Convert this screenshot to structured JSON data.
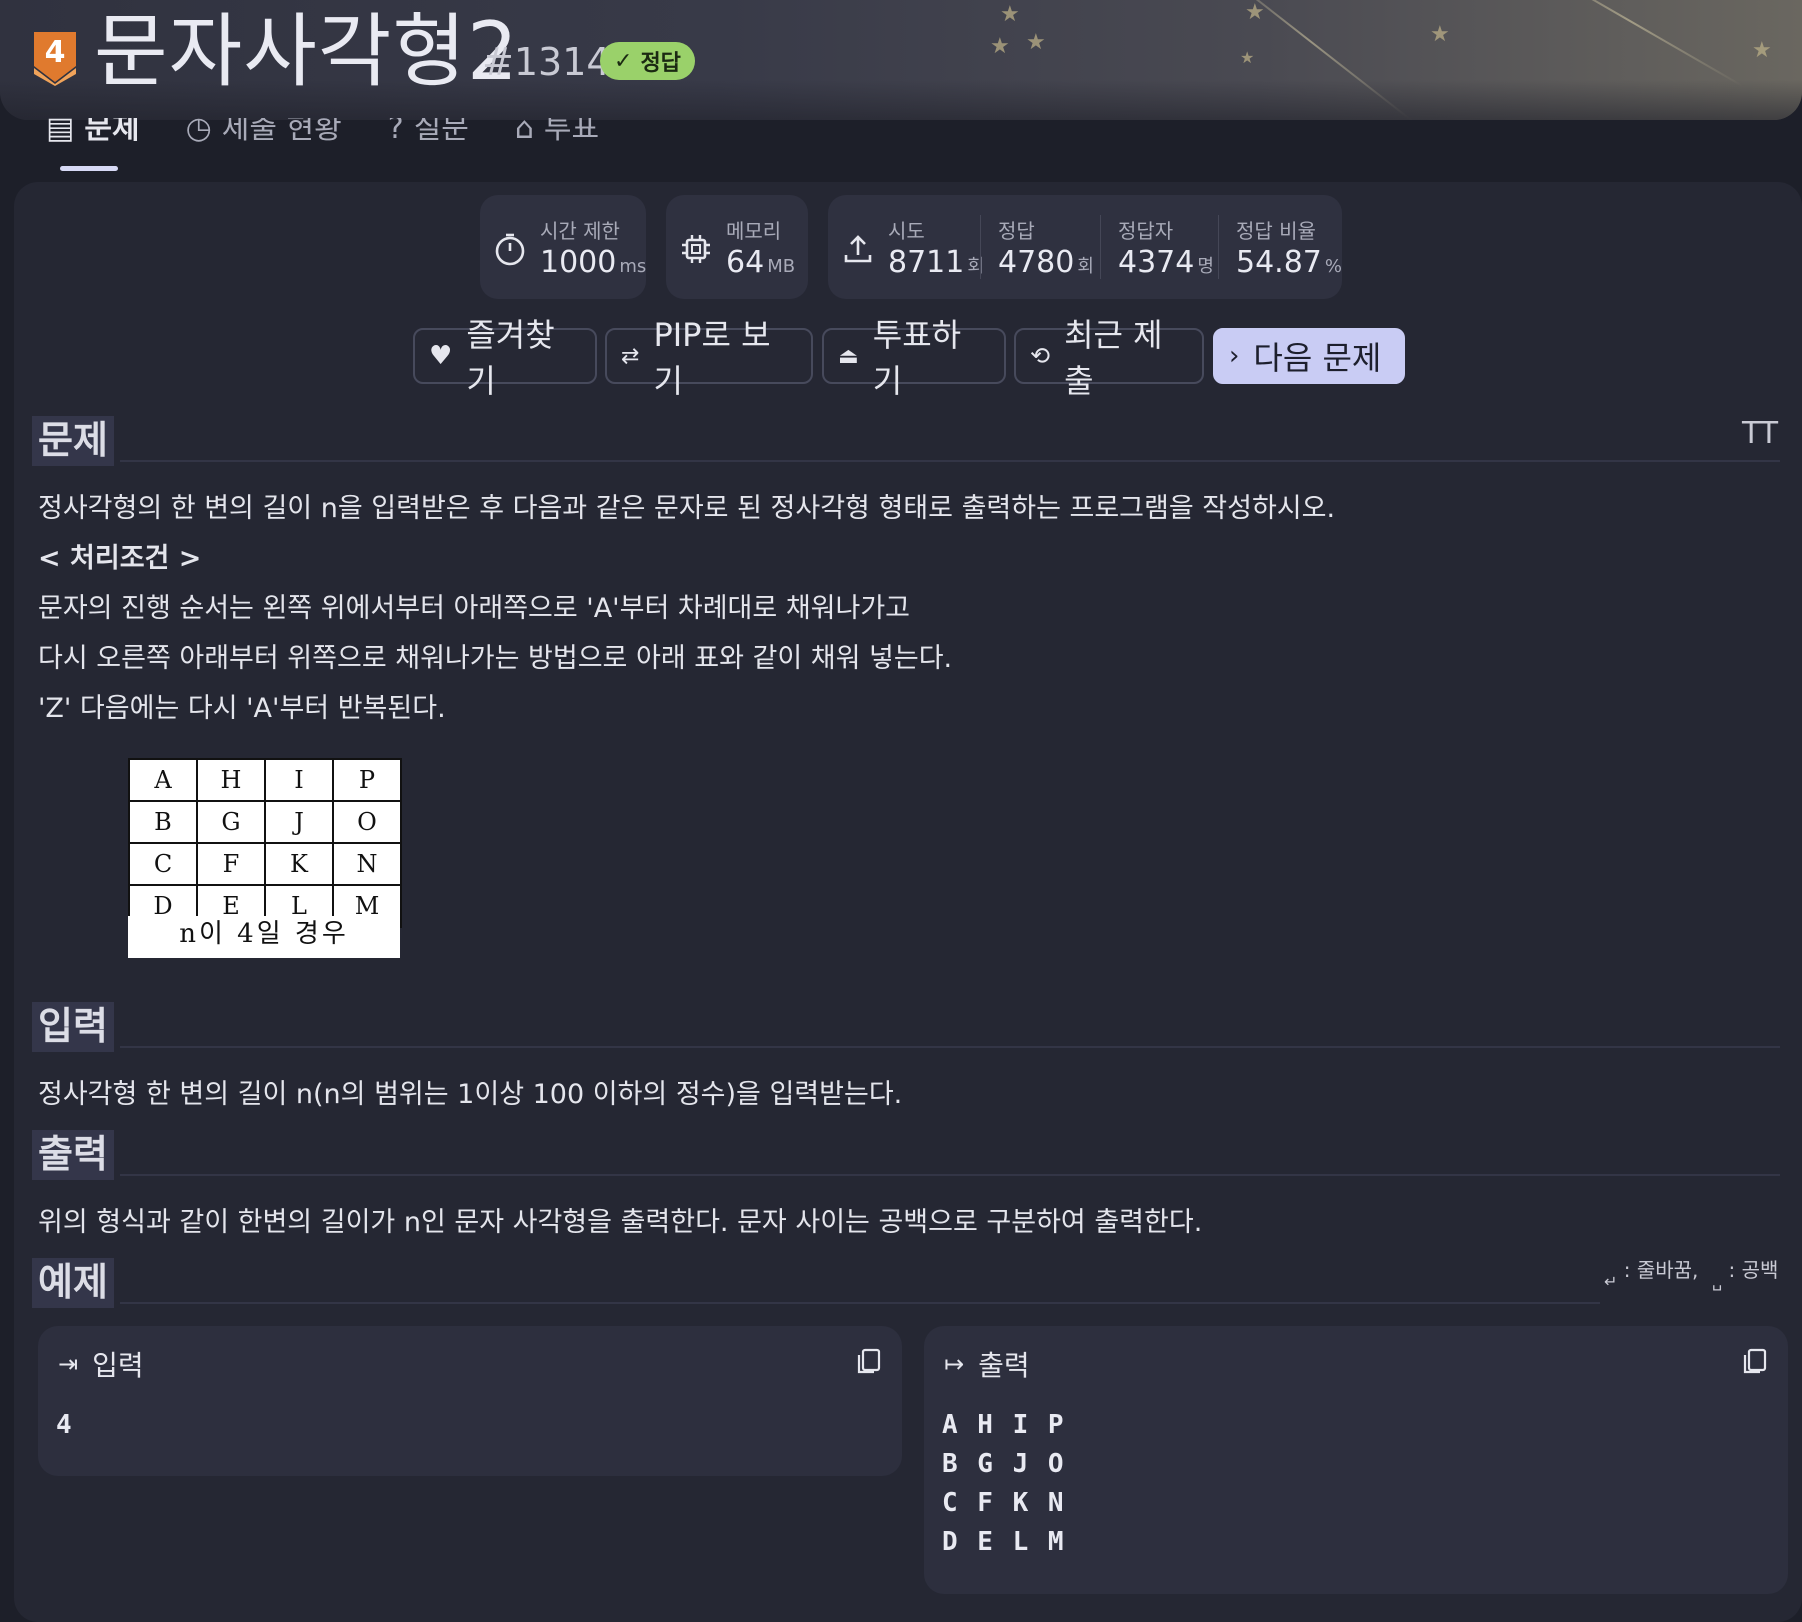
{
  "header": {
    "tier": "4",
    "title": "문자사각형2",
    "problem_id": "#1314",
    "status_badge": "정답"
  },
  "tabs": [
    {
      "label": "문제",
      "icon": "document-icon"
    },
    {
      "label": "제출 현황",
      "icon": "clock-icon"
    },
    {
      "label": "질문",
      "icon": "question-icon"
    },
    {
      "label": "투표",
      "icon": "vote-icon"
    }
  ],
  "stats": {
    "time_limit": {
      "label": "시간 제한",
      "value": "1000",
      "unit": "ms"
    },
    "memory": {
      "label": "메모리",
      "value": "64",
      "unit": "MB"
    },
    "attempts": {
      "label": "시도",
      "value": "8711",
      "unit": "회"
    },
    "correct": {
      "label": "정답",
      "value": "4780",
      "unit": "회"
    },
    "solvers": {
      "label": "정답자",
      "value": "4374",
      "unit": "명"
    },
    "ratio": {
      "label": "정답 비율",
      "value": "54.87",
      "unit": "%"
    }
  },
  "actions": {
    "favorite": "즐겨찾기",
    "pip": "PIP로 보기",
    "vote": "투표하기",
    "recent": "최근 제출",
    "next": "다음 문제"
  },
  "problem": {
    "title": "문제",
    "font_toggle": "TT",
    "line1": "정사각형의 한 변의 길이 n을 입력받은 후 다음과 같은 문자로 된 정사각형 형태로 출력하는 프로그램을 작성하시오.",
    "line2": "< 처리조건 >",
    "line3": "문자의 진행 순서는 왼쪽 위에서부터 아래쪽으로 'A'부터 차례대로 채워나가고",
    "line4": "다시 오른쪽 아래부터 위쪽으로 채워나가는 방법으로 아래 표와 같이 채워 넣는다.",
    "line5": "'Z' 다음에는 다시 'A'부터 반복된다.",
    "figure": {
      "rows": [
        [
          "A",
          "H",
          "I",
          "P"
        ],
        [
          "B",
          "G",
          "J",
          "O"
        ],
        [
          "C",
          "F",
          "K",
          "N"
        ],
        [
          "D",
          "E",
          "L",
          "M"
        ]
      ],
      "caption": "n이 4일 경우"
    }
  },
  "input_section": {
    "title": "입력",
    "text": "정사각형 한 변의 길이 n(n의 범위는 1이상 100 이하의 정수)을 입력받는다."
  },
  "output_section": {
    "title": "출력",
    "text": "위의 형식과 같이 한변의 길이가 n인 문자 사각형을 출력한다. 문자 사이는 공백으로 구분하여 출력한다."
  },
  "example": {
    "title": "예제",
    "legend_newline": ": 줄바꿈,",
    "legend_space": ": 공백",
    "input_label": "입력",
    "input_lines": [
      "4"
    ],
    "output_label": "출력",
    "output_lines": [
      "A H I P",
      "B G J O",
      "C F K N",
      "D E L M"
    ]
  },
  "colors": {
    "background": "#1d1f29",
    "card": "#252733",
    "solved_badge": "#9ad16a",
    "primary_button": "#c9ccf4",
    "tier_badge": "#e07a2e"
  }
}
